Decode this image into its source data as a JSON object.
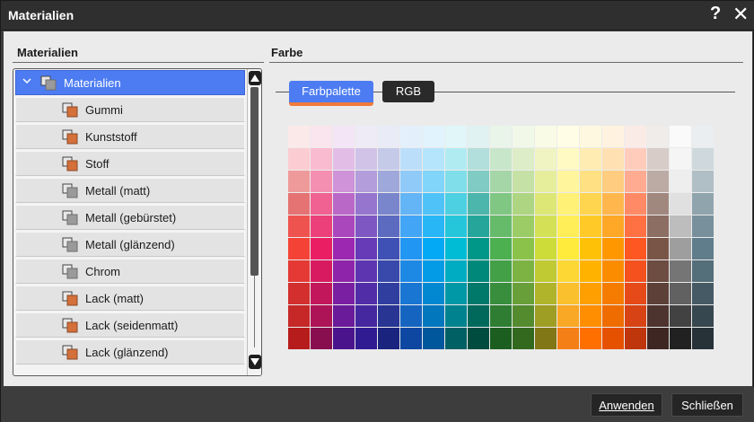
{
  "window": {
    "title": "Materialien",
    "help_glyph": "?",
    "close_glyph": "✕"
  },
  "left_panel": {
    "heading": "Materialien"
  },
  "right_panel": {
    "heading": "Farbe"
  },
  "tree": {
    "root": {
      "label": "Materialien",
      "icon": "material-stack-icon",
      "expanded": true,
      "selected": true
    },
    "items": [
      {
        "label": "Gummi",
        "icon": "material-orange-icon"
      },
      {
        "label": "Kunststoff",
        "icon": "material-orange-icon"
      },
      {
        "label": "Stoff",
        "icon": "material-orange-icon"
      },
      {
        "label": "Metall (matt)",
        "icon": "material-gray-icon"
      },
      {
        "label": "Metall (gebürstet)",
        "icon": "material-gray-icon"
      },
      {
        "label": "Metall (glänzend)",
        "icon": "material-gray-icon"
      },
      {
        "label": "Chrom",
        "icon": "material-gray-icon"
      },
      {
        "label": "Lack (matt)",
        "icon": "material-orange-icon"
      },
      {
        "label": "Lack (seidenmatt)",
        "icon": "material-orange-icon"
      },
      {
        "label": "Lack (glänzend)",
        "icon": "material-orange-icon"
      }
    ]
  },
  "tabs": [
    {
      "label": "Farbpalette",
      "active": true
    },
    {
      "label": "RGB",
      "active": false
    }
  ],
  "palette": {
    "columns": 19,
    "rows": [
      [
        "#fbe9ea",
        "#fae4ed",
        "#f3e5f5",
        "#eeeaf6",
        "#e9ebf7",
        "#e3f0fc",
        "#e1f3fc",
        "#e0f6f8",
        "#e0f2f1",
        "#e9f5e9",
        "#f1f8e8",
        "#f9fbe7",
        "#fffde6",
        "#fff8e0",
        "#fff3df",
        "#fbebe7",
        "#f0ecea",
        "#fafafa",
        "#ebeef0"
      ],
      [
        "#fbcdd2",
        "#f9bbd0",
        "#e2bee7",
        "#d0c3e7",
        "#c5cae9",
        "#bbdefb",
        "#b4e5fc",
        "#b1ebf2",
        "#b2dfdb",
        "#c8e6c9",
        "#dcedc8",
        "#f0f4c3",
        "#fff9c4",
        "#ffecb3",
        "#ffe0b2",
        "#ffccbc",
        "#d7ccc8",
        "#f5f5f5",
        "#cfd8dc"
      ],
      [
        "#ef9a9a",
        "#f48fb1",
        "#ce93d8",
        "#b39ddb",
        "#9fa8da",
        "#90caf9",
        "#81d4fa",
        "#80deea",
        "#80cbc4",
        "#a5d6a7",
        "#c5e1a5",
        "#e6ee9c",
        "#fff59d",
        "#ffe082",
        "#ffcc80",
        "#ffab91",
        "#bcaaa4",
        "#eeeeee",
        "#b0bec5"
      ],
      [
        "#e57373",
        "#f06292",
        "#ba68c8",
        "#9575cd",
        "#7986cb",
        "#64b5f6",
        "#4fc3f7",
        "#4dd0e1",
        "#4db6ac",
        "#81c784",
        "#aed581",
        "#dce775",
        "#fff176",
        "#ffd54f",
        "#ffb74d",
        "#ff8a65",
        "#a1887f",
        "#e0e0e0",
        "#90a4ae"
      ],
      [
        "#ef5350",
        "#ec407a",
        "#ab47bc",
        "#7e57c2",
        "#5c6bc0",
        "#42a5f5",
        "#29b6f6",
        "#26c6da",
        "#26a69a",
        "#66bb6a",
        "#9ccc65",
        "#d4e157",
        "#ffee58",
        "#ffca28",
        "#ffa726",
        "#ff7043",
        "#8d6e63",
        "#bdbdbd",
        "#78909c"
      ],
      [
        "#f44336",
        "#e91e63",
        "#9c27b0",
        "#673ab7",
        "#3f51b5",
        "#2196f3",
        "#03a9f4",
        "#00bcd4",
        "#009688",
        "#4caf50",
        "#8bc34a",
        "#cddc39",
        "#ffeb3b",
        "#ffc107",
        "#ff9800",
        "#ff5722",
        "#795548",
        "#9e9e9e",
        "#607d8b"
      ],
      [
        "#e53935",
        "#d81b60",
        "#8e24aa",
        "#5e35b1",
        "#3949ab",
        "#1e88e5",
        "#039be5",
        "#00acc1",
        "#00897b",
        "#43a047",
        "#7cb342",
        "#c0ca33",
        "#fdd835",
        "#ffb300",
        "#fb8c00",
        "#f4511e",
        "#6d4c41",
        "#757575",
        "#546e7a"
      ],
      [
        "#d32f2f",
        "#c2185b",
        "#7b1fa2",
        "#512da8",
        "#303f9f",
        "#1976d2",
        "#0288d1",
        "#0097a7",
        "#00796b",
        "#388e3c",
        "#689f38",
        "#afb42b",
        "#fbc02d",
        "#ffa000",
        "#f57c00",
        "#e64a19",
        "#5d4037",
        "#616161",
        "#455a64"
      ],
      [
        "#c62828",
        "#ad1457",
        "#6a1b9a",
        "#4527a0",
        "#283593",
        "#1565c0",
        "#0277bd",
        "#00838f",
        "#00695c",
        "#2e7d32",
        "#558b2f",
        "#9e9d24",
        "#f9a825",
        "#ff8f00",
        "#ef6c00",
        "#d84315",
        "#4e342e",
        "#424242",
        "#37474f"
      ],
      [
        "#b71c1c",
        "#880e4f",
        "#4a148c",
        "#311b92",
        "#1a237e",
        "#0d47a1",
        "#01579b",
        "#006064",
        "#004d40",
        "#1b5e20",
        "#33691e",
        "#827717",
        "#f57f17",
        "#ff6f00",
        "#e65100",
        "#bf360c",
        "#3e2723",
        "#212121",
        "#263238"
      ]
    ]
  },
  "footer": {
    "apply_label": "Anwenden",
    "close_label": "Schließen"
  },
  "colors": {
    "accent": "#4d7cf2",
    "tab_underline": "#f07a3a",
    "titlebar": "#2f2f2f"
  }
}
